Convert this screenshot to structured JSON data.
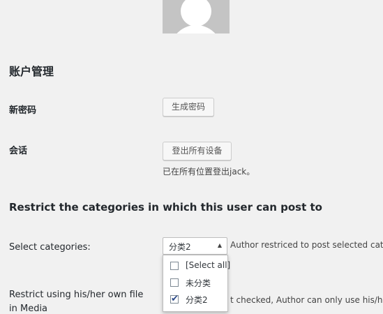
{
  "account": {
    "section_title": "账户管理",
    "new_password_label": "新密码",
    "generate_password_button": "生成密码",
    "sessions_label": "会话",
    "logout_everywhere_button": "登出所有设备",
    "sessions_desc": "已在所有位置登出jack。"
  },
  "restrict": {
    "section_title": "Restrict the categories in which this user can post to",
    "select_label": "Select categories:",
    "select_value": "分类2",
    "select_arrow": "▲",
    "select_desc": "Author restriced to post selected cate",
    "media_label_line1": "Restrict using his/her own file",
    "media_label_line2": "in Media",
    "media_desc": "t checked, Author can only use his/he",
    "options": [
      {
        "label": "[Select all]",
        "checked": false
      },
      {
        "label": "未分类",
        "checked": false
      },
      {
        "label": "分类2",
        "checked": true
      }
    ],
    "check_glyph": "✔"
  },
  "colors": {
    "background": "#f1f1f1",
    "avatar_bg": "#c4c4c4",
    "text": "#23282d"
  }
}
